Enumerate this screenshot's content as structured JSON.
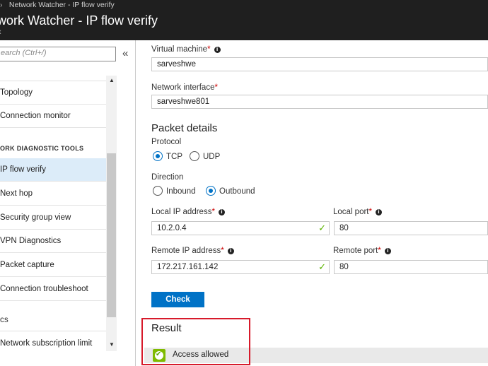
{
  "header": {
    "breadcrumb": "Network Watcher - IP flow verify",
    "title": "work Watcher - IP flow verify",
    "subtitle": "ft"
  },
  "sidebar": {
    "search_placeholder": "earch (Ctrl+/)",
    "collapse_glyph": "«",
    "items": [
      {
        "label": "Topology"
      },
      {
        "label": "Connection monitor"
      },
      {
        "label": "IP flow verify"
      },
      {
        "label": "Next hop"
      },
      {
        "label": "Security group view"
      },
      {
        "label": "VPN Diagnostics"
      },
      {
        "label": "Packet capture"
      },
      {
        "label": "Connection troubleshoot"
      },
      {
        "label": "Network subscription limit"
      }
    ],
    "section_heading": "ORK DIAGNOSTIC TOOLS",
    "section_heading2": "cs"
  },
  "form": {
    "vm_label": "Virtual machine",
    "vm_value": "sarveshwe",
    "nic_label": "Network interface",
    "nic_value": "sarveshwe801",
    "packet_details_title": "Packet details",
    "protocol_label": "Protocol",
    "protocol_options": [
      "TCP",
      "UDP"
    ],
    "protocol_selected": "TCP",
    "direction_label": "Direction",
    "direction_options": [
      "Inbound",
      "Outbound"
    ],
    "direction_selected": "Outbound",
    "local_ip_label": "Local IP address",
    "local_ip_value": "10.2.0.4",
    "local_port_label": "Local port",
    "local_port_value": "80",
    "remote_ip_label": "Remote IP address",
    "remote_ip_value": "172.217.161.142",
    "remote_port_label": "Remote port",
    "remote_port_value": "80",
    "required_marker": "*",
    "check_button": "Check"
  },
  "result": {
    "title": "Result",
    "status": "Access allowed"
  },
  "colors": {
    "accent": "#0072c6",
    "header_bg": "#1f1f1f",
    "highlight_box": "#d71a2b",
    "success": "#7fba00"
  }
}
